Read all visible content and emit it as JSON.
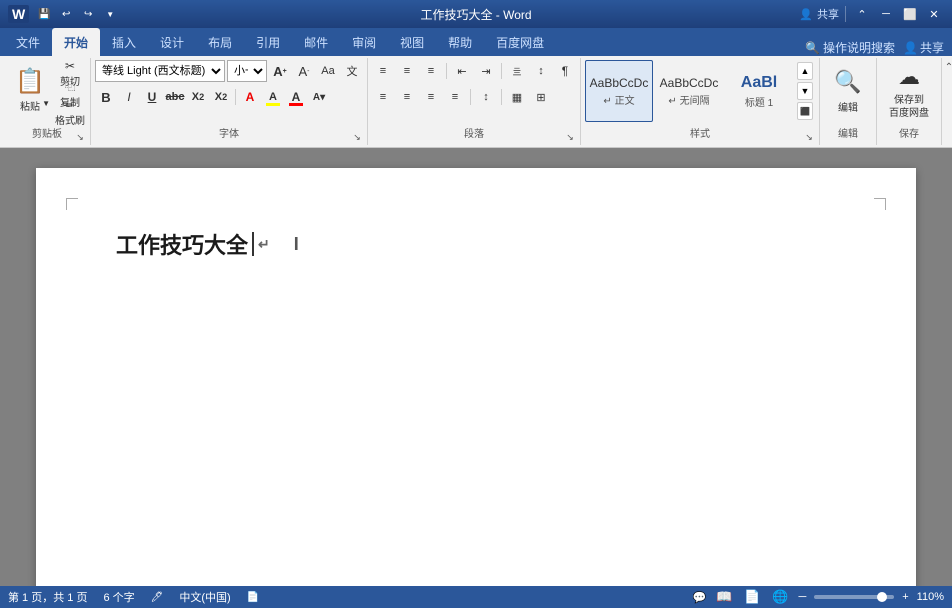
{
  "titleBar": {
    "title": "工作技巧大全 - Word",
    "quickAccess": [
      "save-icon",
      "undo-icon",
      "redo-icon",
      "customize-icon"
    ],
    "controls": [
      "minimize-icon",
      "restore-icon",
      "close-icon"
    ],
    "userIcon": "user-icon",
    "shareLabel": "共享"
  },
  "ribbon": {
    "tabs": [
      {
        "id": "file",
        "label": "文件",
        "active": false
      },
      {
        "id": "home",
        "label": "开始",
        "active": true
      },
      {
        "id": "insert",
        "label": "插入",
        "active": false
      },
      {
        "id": "design",
        "label": "设计",
        "active": false
      },
      {
        "id": "layout",
        "label": "布局",
        "active": false
      },
      {
        "id": "references",
        "label": "引用",
        "active": false
      },
      {
        "id": "mail",
        "label": "邮件",
        "active": false
      },
      {
        "id": "review",
        "label": "审阅",
        "active": false
      },
      {
        "id": "view",
        "label": "视图",
        "active": false
      },
      {
        "id": "help",
        "label": "帮助",
        "active": false
      },
      {
        "id": "baidu-disk",
        "label": "百度网盘",
        "active": false
      }
    ],
    "rightItems": [
      {
        "id": "search",
        "label": "操作说明搜索",
        "icon": "search-icon"
      },
      {
        "id": "share",
        "label": "共享"
      }
    ]
  },
  "groups": {
    "clipboard": {
      "label": "剪贴板",
      "paste": "粘贴",
      "cut": "✂",
      "copy": "⿻",
      "formatPainter": "✏"
    },
    "font": {
      "label": "字体",
      "fontName": "等线 Light (西文标题)",
      "fontSize": "小一",
      "bold": "B",
      "italic": "I",
      "underline": "U",
      "strikethrough": "abc",
      "subscript": "X₂",
      "superscript": "X²",
      "clearFormat": "A",
      "fontColor": "A",
      "highlight": "A",
      "enlargeFont": "A↑",
      "shrinkFont": "A↓",
      "changeCase": "Aa",
      "wenzhi": "文"
    },
    "paragraph": {
      "label": "段落",
      "bullets": "≡",
      "numbering": "≡",
      "multilevel": "≡",
      "decreaseIndent": "⇤",
      "increaseIndent": "⇥",
      "sort": "↕",
      "showHide": "¶",
      "alignLeft": "≡",
      "center": "≡",
      "alignRight": "≡",
      "justify": "≡",
      "lineSpacing": "↕",
      "shading": "▦",
      "borders": "⊞"
    },
    "styles": {
      "label": "样式",
      "items": [
        {
          "id": "normal",
          "label": "正文",
          "preview": "AaBbCcDc",
          "active": true
        },
        {
          "id": "noSpacing",
          "label": "无间隔",
          "preview": "AaBbCcDc"
        },
        {
          "id": "heading1",
          "label": "标题 1",
          "preview": "AaBl"
        }
      ]
    },
    "editing": {
      "label": "编辑",
      "icon": "🔍",
      "btnLabel": "编辑"
    },
    "baidu": {
      "label": "保存",
      "saveLabel": "保存到\n百度网盘",
      "icon": "☁"
    }
  },
  "document": {
    "title": "工作技巧大全",
    "paragraphMark": "↵"
  },
  "statusBar": {
    "page": "第 1 页，共 1 页",
    "words": "6 个字",
    "lang": "中文(中国)",
    "zoomLevel": "110%",
    "views": [
      "阅读",
      "页面视图",
      "Web版式"
    ]
  }
}
